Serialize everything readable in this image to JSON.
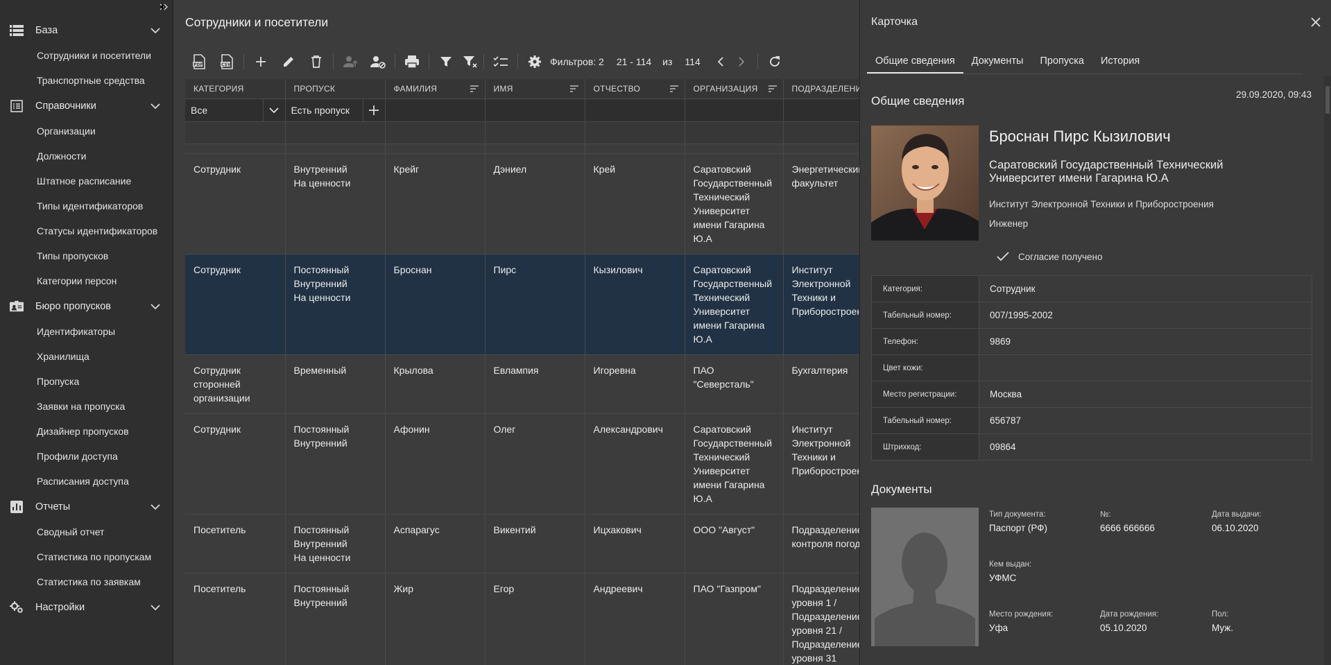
{
  "sidebar": {
    "sections": [
      {
        "label": "База",
        "icon": "list-icon",
        "items": [
          "Сотрудники и посетители",
          "Транспортные средства"
        ]
      },
      {
        "label": "Справочники",
        "icon": "directory-icon",
        "items": [
          "Организации",
          "Должности",
          "Штатное расписание",
          "Типы идентификаторов",
          "Статусы идентификаторов",
          "Типы пропусков",
          "Категории персон"
        ]
      },
      {
        "label": "Бюро пропусков",
        "icon": "badge-icon",
        "items": [
          "Идентификаторы",
          "Хранилища",
          "Пропуска",
          "Заявки на пропуска",
          "Дизайнер пропусков",
          "Профили доступа",
          "Расписания доступа"
        ]
      },
      {
        "label": "Отчеты",
        "icon": "report-icon",
        "items": [
          "Сводный отчет",
          "Статистика по пропускам",
          "Статистика по заявкам"
        ]
      },
      {
        "label": "Настройки",
        "icon": "settings-cogs-icon",
        "items": []
      }
    ]
  },
  "main": {
    "title": "Сотрудники и посетители",
    "toolbar": {
      "filters_label": "Фильтров: 2",
      "range": "21 - 114",
      "of_label": "из",
      "total": "114"
    },
    "columns": [
      "КАТЕГОРИЯ",
      "ПРОПУСК",
      "ФАМИЛИЯ",
      "ИМЯ",
      "ОТЧЕСТВО",
      "ОРГАНИЗАЦИЯ",
      "ПОДРАЗДЕЛЕНИЕ"
    ],
    "filters": {
      "category": "Все",
      "pass": "Есть пропуск"
    },
    "rows": [
      {
        "category": [
          "Сотрудник"
        ],
        "pass": [
          "Внутренний",
          "На ценности"
        ],
        "last": "Крейг",
        "first": "Дэниел",
        "middle": "Крей",
        "org": [
          "Саратовский",
          "Государственный",
          "Технический",
          "Университет",
          "имени Гагарина",
          "Ю.А"
        ],
        "dept": [
          "Энергетический",
          "факультет"
        ],
        "selected": false
      },
      {
        "category": [
          "Сотрудник"
        ],
        "pass": [
          "Постоянный",
          "Внутренний",
          "На ценности"
        ],
        "last": "Броснан",
        "first": "Пирс",
        "middle": "Кызилович",
        "org": [
          "Саратовский",
          "Государственный",
          "Технический",
          "Университет",
          "имени Гагарина",
          "Ю.А"
        ],
        "dept": [
          "Институт",
          "Электронной",
          "Техники и",
          "Приборостроения"
        ],
        "selected": true
      },
      {
        "category": [
          "Сотрудник",
          "сторонней",
          "организации"
        ],
        "pass": [
          "Временный"
        ],
        "last": "Крылова",
        "first": "Евлампия",
        "middle": "Игоревна",
        "org": [
          "ПАО",
          "\"Северсталь\""
        ],
        "dept": [
          "Бухгалтерия"
        ],
        "selected": false
      },
      {
        "category": [
          "Сотрудник"
        ],
        "pass": [
          "Постоянный",
          "Внутренний"
        ],
        "last": "Афонин",
        "first": "Олег",
        "middle": "Александрович",
        "org": [
          "Саратовский",
          "Государственный",
          "Технический",
          "Университет",
          "имени Гагарина",
          "Ю.А"
        ],
        "dept": [
          "Институт",
          "Электронной",
          "Техники и",
          "Приборостроения"
        ],
        "selected": false
      },
      {
        "category": [
          "Посетитель"
        ],
        "pass": [
          "Постоянный",
          "Внутренний",
          "На ценности"
        ],
        "last": "Аспарагус",
        "first": "Викентий",
        "middle": "Ицхакович",
        "org": [
          "ООО \"Август\""
        ],
        "dept": [
          "Подразделение",
          "контроля погоды"
        ],
        "selected": false
      },
      {
        "category": [
          "Посетитель"
        ],
        "pass": [
          "Постоянный",
          "Внутренний"
        ],
        "last": "Жир",
        "first": "Егор",
        "middle": "Андреевич",
        "org": [
          "ПАО \"Газпром\""
        ],
        "dept": [
          "Подразделение",
          "уровня 1 /",
          "Подразделение",
          "уровня 21 /",
          "Подразделение",
          "уровня 31"
        ],
        "selected": false
      }
    ]
  },
  "card": {
    "title": "Карточка",
    "tabs": [
      "Общие сведения",
      "Документы",
      "Пропуска",
      "История"
    ],
    "general_heading": "Общие сведения",
    "date": "29.09.2020, 09:43",
    "name": "Броснан Пирс Кызилович",
    "org": "Саратовский Государственный Технический Университет имени Гагарина Ю.А",
    "dept": "Институт Электронной Техники и Приборостроения",
    "position": "Инженер",
    "consent": "Согласие получено",
    "props": [
      {
        "k": "Категория:",
        "v": "Сотрудник"
      },
      {
        "k": "Табельный номер:",
        "v": "007/1995-2002"
      },
      {
        "k": "Телефон:",
        "v": "9869"
      },
      {
        "k": "Цвет кожи:",
        "v": ""
      },
      {
        "k": "Место регистрации:",
        "v": "Москва"
      },
      {
        "k": "Табельный номер:",
        "v": "656787"
      },
      {
        "k": "Штрихкод:",
        "v": "09864"
      }
    ],
    "documents_heading": "Документы",
    "doc": {
      "type_label": "Тип документа:",
      "type": "Паспорт (РФ)",
      "num_label": "№:",
      "num": "6666 666666",
      "issue_date_label": "Дата выдачи:",
      "issue_date": "06.10.2020",
      "issued_by_label": "Кем выдан:",
      "issued_by": "УФМС",
      "birthplace_label": "Место рождения:",
      "birthplace": "Уфа",
      "birthdate_label": "Дата рождения:",
      "birthdate": "05.10.2020",
      "sex_label": "Пол:",
      "sex": "Муж."
    }
  }
}
